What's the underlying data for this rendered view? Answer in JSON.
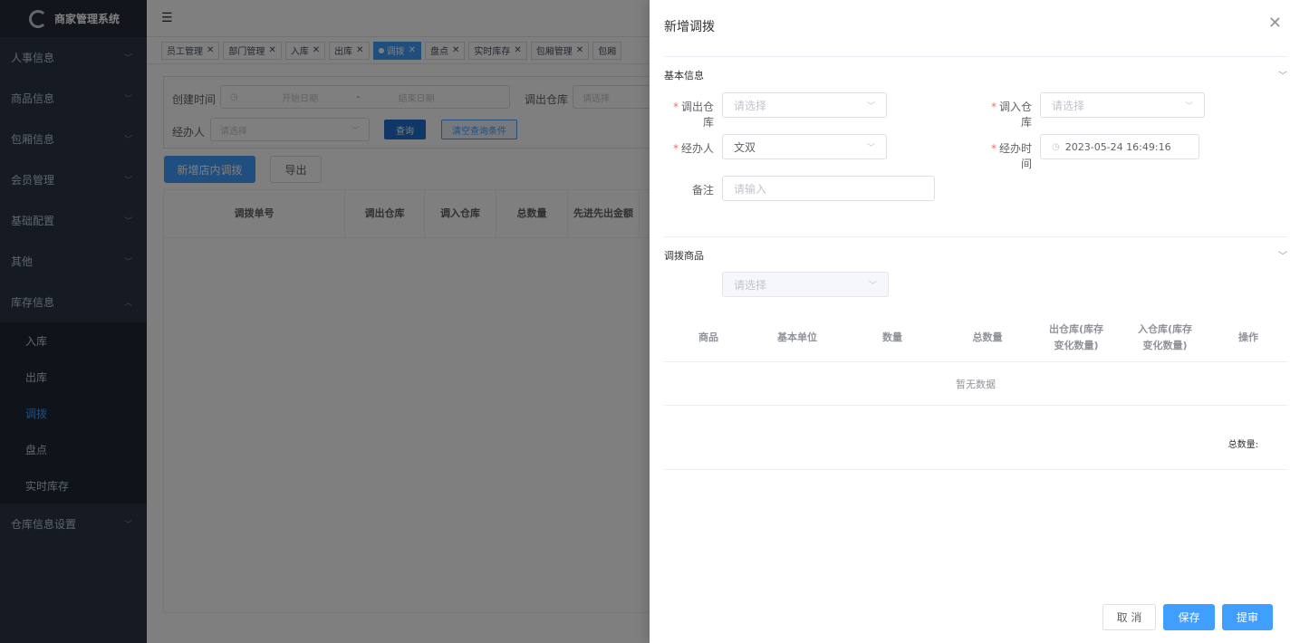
{
  "app": {
    "title": "商家管理系统"
  },
  "sidebar": {
    "items": [
      {
        "label": "人事信息"
      },
      {
        "label": "商品信息"
      },
      {
        "label": "包厢信息"
      },
      {
        "label": "会员管理"
      },
      {
        "label": "基础配置"
      },
      {
        "label": "其他"
      },
      {
        "label": "库存信息"
      }
    ],
    "stock_sub": [
      "入库",
      "出库",
      "调拨",
      "盘点",
      "实时库存"
    ],
    "last_item": "仓库信息设置"
  },
  "tabs": [
    "员工管理",
    "部门管理",
    "入库",
    "出库",
    "调拨",
    "盘点",
    "实时库存",
    "包厢管理",
    "包厢"
  ],
  "search": {
    "create_time_label": "创建时间",
    "start_placeholder": "开始日期",
    "range_sep": "-",
    "end_placeholder": "结束日期",
    "out_wh_label": "调出仓库",
    "out_wh_placeholder": "请选择",
    "handler_label": "经办人",
    "handler_placeholder": "请选择",
    "query_btn": "查询",
    "clear_btn": "清空查询条件"
  },
  "actions": {
    "add_btn": "新增店内调拨",
    "export_btn": "导出"
  },
  "list_table": {
    "headers": [
      "调拨单号",
      "调出仓库",
      "调入仓库",
      "总数量",
      "先进先出金额"
    ]
  },
  "drawer": {
    "title": "新增调拨",
    "basic_section": "基本信息",
    "out_wh_label": "调出仓库",
    "out_wh_placeholder": "请选择",
    "in_wh_label": "调入仓库",
    "in_wh_placeholder": "请选择",
    "handler_label": "经办人",
    "handler_value": "文双",
    "time_label": "经办时间",
    "time_value": "2023-05-24 16:49:16",
    "remark_label": "备注",
    "remark_placeholder": "请输入",
    "goods_section": "调拨商品",
    "goods_placeholder": "请选择",
    "goods_headers": [
      "商品",
      "基本单位",
      "数量",
      "总数量",
      "出仓库(库存变化数量)",
      "入仓库(库存变化数量)",
      "操作"
    ],
    "empty_text": "暂无数据",
    "total_label": "总数量:",
    "cancel_btn": "取 消",
    "save_btn": "保存",
    "submit_btn": "提审"
  }
}
